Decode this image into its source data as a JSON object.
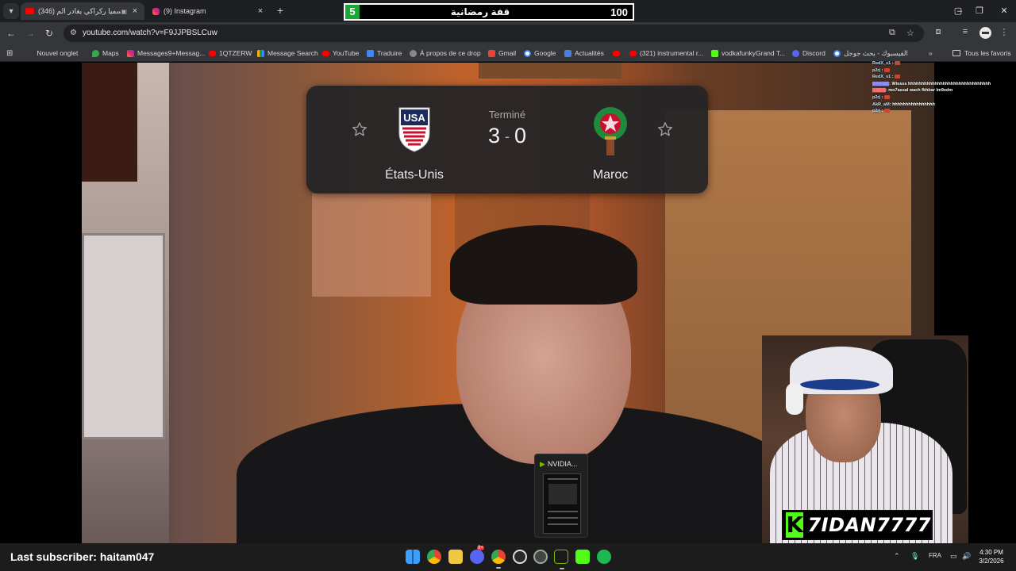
{
  "browser": {
    "tabs": [
      {
        "title": "(346) رسميا ركراكي يغادر الم...",
        "active": true,
        "favicon": "youtube-icon"
      },
      {
        "title": "(9) Instagram",
        "active": false,
        "favicon": "instagram-icon"
      }
    ],
    "url": "youtube.com/watch?v=F9JJPBSLCuw",
    "bookmarks_bar": [
      {
        "label": "Nouvel onglet",
        "icon": "apps-icon"
      },
      {
        "label": "Maps",
        "icon": "maps-icon"
      },
      {
        "label": "Messages9+Messag...",
        "icon": "instagram-icon"
      },
      {
        "label": "1QTZERW",
        "icon": "youtube-icon"
      },
      {
        "label": "Message Search",
        "icon": "chart-icon"
      },
      {
        "label": "YouTube",
        "icon": "youtube-icon"
      },
      {
        "label": "Traduire",
        "icon": "translate-icon"
      },
      {
        "label": "À propos de ce drop",
        "icon": "globe-icon"
      },
      {
        "label": "Gmail",
        "icon": "gmail-icon"
      },
      {
        "label": "Google",
        "icon": "google-icon"
      },
      {
        "label": "Actualités",
        "icon": "news-icon"
      },
      {
        "label": "",
        "icon": "youtube-icon"
      },
      {
        "label": "(321) instrumental r...",
        "icon": "youtube-icon"
      },
      {
        "label": "vodkafunkyGrand T...",
        "icon": "kick-icon"
      },
      {
        "label": "Discord",
        "icon": "discord-icon"
      },
      {
        "label": "الفيسبوك - بحث جوجل",
        "icon": "google-icon"
      }
    ],
    "all_bookmarks": "Tous les favoris"
  },
  "banner": {
    "left_value": "5",
    "title": "قفة رمضانية",
    "right_value": "100"
  },
  "scorecard": {
    "status": "Terminé",
    "home_score": "3",
    "away_score": "0",
    "home_team": "États-Unis",
    "away_team": "Maroc",
    "home_logo_text": "USA"
  },
  "chat": [
    {
      "user": "RedX_v1",
      "message": ""
    },
    {
      "user": "p2rj",
      "message": ""
    },
    {
      "user": "RedX_v1",
      "message": ""
    },
    {
      "user": "",
      "message": ": Wissss hhhhhhhhhhhhhhhhhhhhhhhhhhhhhhh"
    },
    {
      "user": "",
      "message": ": mo7assal wach fkhbar lm9edm"
    },
    {
      "user": "p2rj",
      "message": ""
    },
    {
      "user": "AkR_aM",
      "message": ": hhhhhhhhhhhhhhhh"
    },
    {
      "user": "p2rj",
      "message": ""
    }
  ],
  "streamer": {
    "name": "7IDAN7777",
    "last_subscriber": "Last subscriber: haitam047"
  },
  "nvidia_preview": {
    "title": "NVIDIA..."
  },
  "taskbar": {
    "language": "FRA",
    "time": "4:30 PM",
    "date": "3/2/2026",
    "discord_badge": "9+"
  },
  "colors": {
    "accent_green": "#53fc18",
    "banner_green": "#19a834",
    "browser_bg": "#35363a"
  }
}
